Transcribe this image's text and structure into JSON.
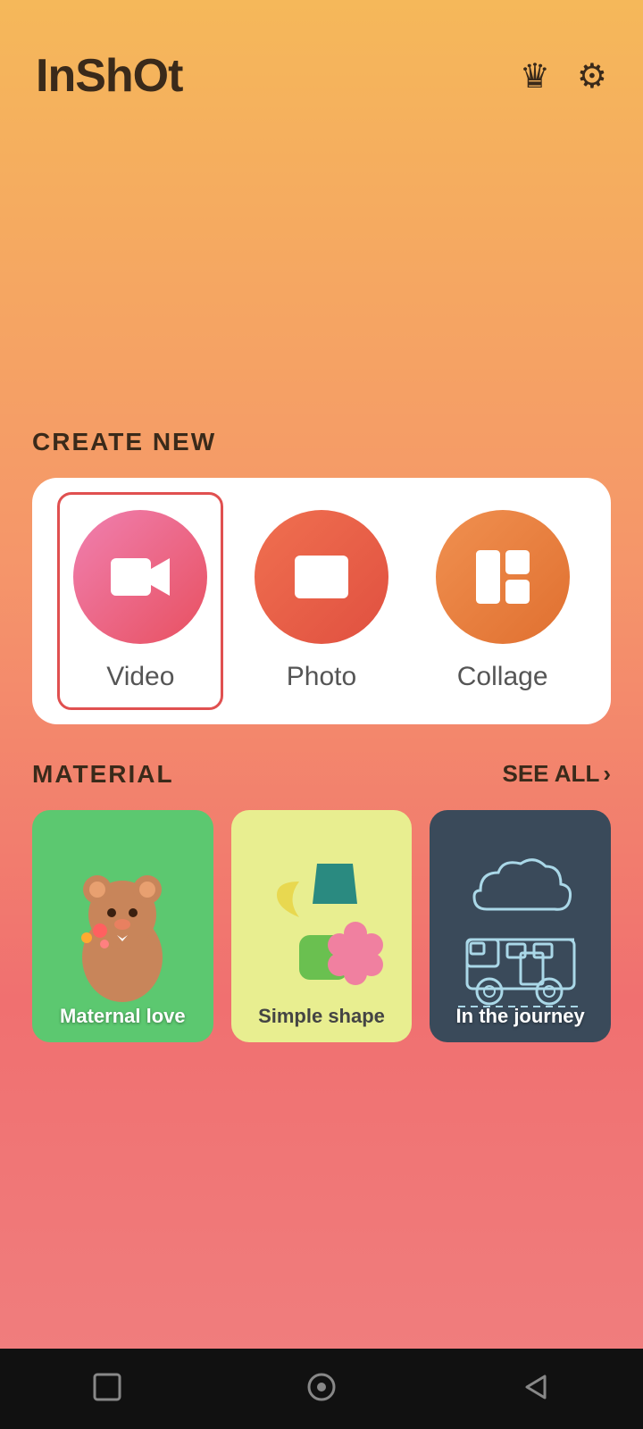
{
  "app": {
    "title": "InShOt"
  },
  "header": {
    "crown_icon": "♛",
    "gear_icon": "⚙"
  },
  "create_new": {
    "section_label": "CREATE NEW",
    "items": [
      {
        "id": "video",
        "label": "Video",
        "selected": true
      },
      {
        "id": "photo",
        "label": "Photo",
        "selected": false
      },
      {
        "id": "collage",
        "label": "Collage",
        "selected": false
      }
    ]
  },
  "material": {
    "section_label": "MATERIAL",
    "see_all_label": "SEE ALL",
    "cards": [
      {
        "id": "maternal-love",
        "label": "Maternal love",
        "bg": "#5CC870"
      },
      {
        "id": "simple-shape",
        "label": "Simple shape",
        "bg": "#E8EE90"
      },
      {
        "id": "in-the-journey",
        "label": "In the journey",
        "bg": "#3a4a5a"
      }
    ]
  },
  "bottom_nav": {
    "square_icon": "▢",
    "circle_icon": "◯",
    "triangle_icon": "◁"
  }
}
